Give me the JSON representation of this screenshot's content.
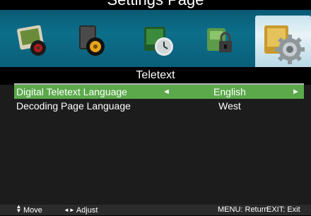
{
  "header": {
    "caption": "Settings Page"
  },
  "menu_icons": [
    {
      "name": "picture-icon",
      "selected": false
    },
    {
      "name": "sound-icon",
      "selected": false
    },
    {
      "name": "time-icon",
      "selected": false
    },
    {
      "name": "lock-icon",
      "selected": false
    },
    {
      "name": "setup-icon",
      "selected": true
    }
  ],
  "panel": {
    "title": "Teletext",
    "rows": [
      {
        "label": "Digital Teletext Language",
        "value": "English",
        "selected": true,
        "left_arrow": "◄",
        "right_arrow": "►"
      },
      {
        "label": "Decoding Page Language",
        "value": "West",
        "selected": false
      }
    ]
  },
  "footer": {
    "move_icon": "up-down-arrows-icon",
    "move_label": "Move",
    "adjust_icon": "left-right-arrows-icon",
    "adjust_label": "Adjust",
    "menu_hint": "MENU: Return",
    "exit_hint": "EXIT: Exit"
  },
  "colors": {
    "selection": "#5ba94b",
    "icon_bar": "#0d6f8b",
    "panel_bg": "#1c1c1c",
    "footer_bg": "#2b2b2b"
  }
}
